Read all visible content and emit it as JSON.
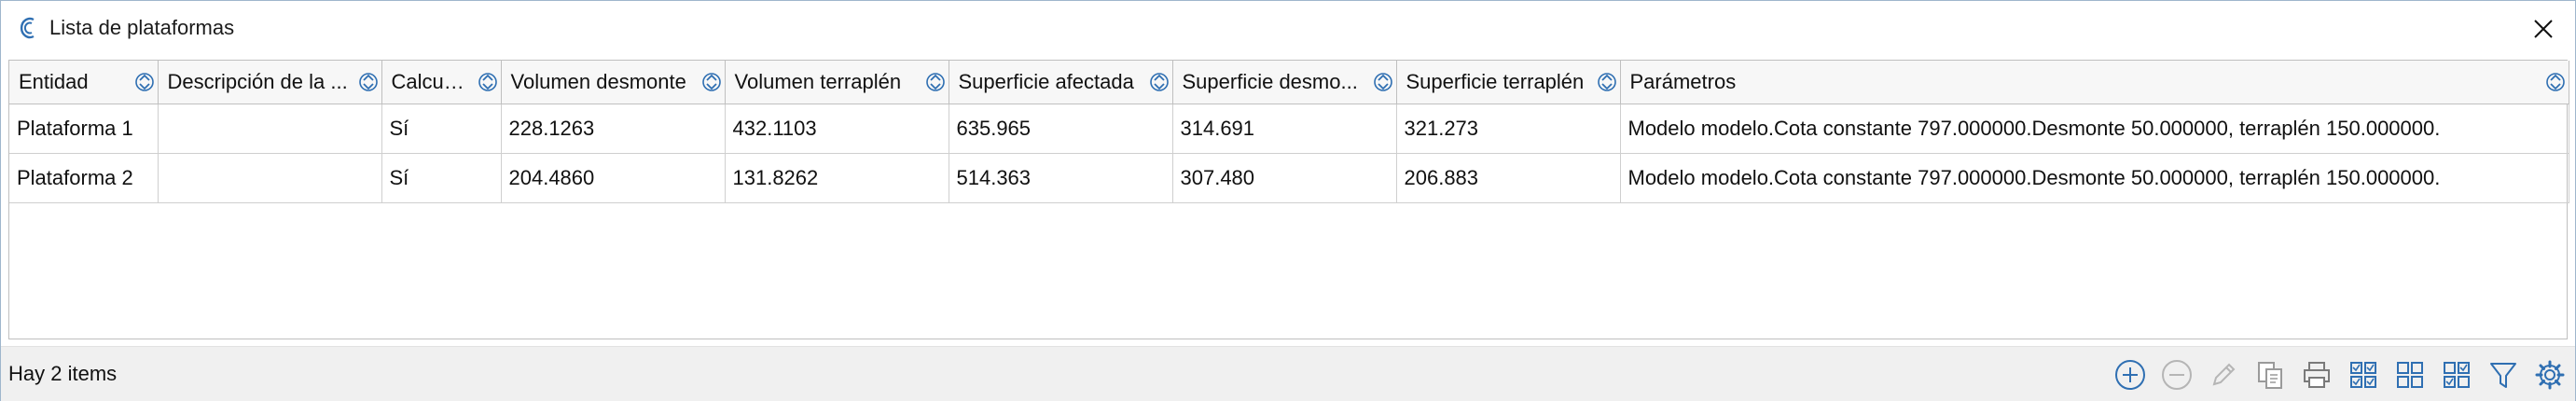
{
  "window": {
    "title": "Lista de plataformas"
  },
  "table": {
    "columns": [
      "Entidad",
      "Descripción de la ...",
      "Calcula...",
      "Volumen desmonte",
      "Volumen terraplén",
      "Superficie afectada",
      "Superficie desmo...",
      "Superficie terraplén",
      "Parámetros"
    ],
    "rows": [
      [
        "Plataforma 1",
        "",
        "Sí",
        "228.1263",
        "432.1103",
        "635.965",
        "314.691",
        "321.273",
        "Modelo modelo.Cota constante 797.000000.Desmonte 50.000000, terraplén 150.000000."
      ],
      [
        "Plataforma 2",
        "",
        "Sí",
        "204.4860",
        "131.8262",
        "514.363",
        "307.480",
        "206.883",
        "Modelo modelo.Cota constante 797.000000.Desmonte 50.000000, terraplén 150.000000."
      ]
    ]
  },
  "status": {
    "text": "Hay 2 items"
  },
  "toolbar": {
    "icons": [
      "add-circle-icon",
      "remove-circle-icon",
      "pencil-icon",
      "copy-icon",
      "printer-icon",
      "select-all-icon",
      "grid-icon",
      "check-grid-icon",
      "filter-icon",
      "gear-icon"
    ]
  },
  "colors": {
    "accent": "#2f6fb2",
    "disabled": "#b5b5b5",
    "grid_line": "#cfcfcf"
  }
}
